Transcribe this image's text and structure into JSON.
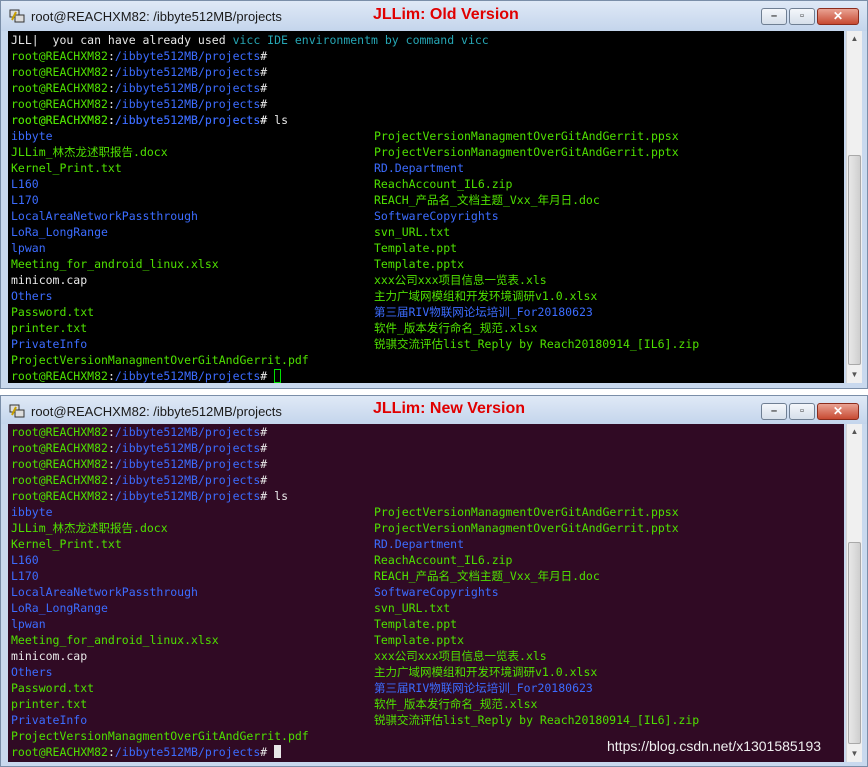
{
  "colors": {
    "green": "#4fe000",
    "blue": "#3c6cff",
    "white": "#e8e8e8",
    "cyan": "#26a6b4"
  },
  "top": {
    "title": "root@REACHXM82: /ibbyte512MB/projects",
    "tag": "JLLim:  Old Version",
    "info": {
      "prefix": "JLL|  you can have already used ",
      "highlight": "vicc IDE environmentm by command vicc"
    },
    "prompt_user": "root@REACHXM82",
    "prompt_sep": ":",
    "prompt_path": "/ibbyte512MB/projects",
    "prompt_end": "#",
    "cmd": " ls"
  },
  "bottom": {
    "title": "root@REACHXM82: /ibbyte512MB/projects",
    "tag": "JLLim: New Version",
    "prompt_user": "root@REACHXM82",
    "prompt_sep": ":",
    "prompt_path": "/ibbyte512MB/projects",
    "prompt_end": "#",
    "cmd": " ls"
  },
  "listing": [
    {
      "left": {
        "text": "ibbyte",
        "kind": "dir"
      },
      "right": {
        "text": "ProjectVersionManagmentOverGitAndGerrit.ppsx",
        "kind": "file"
      }
    },
    {
      "left": {
        "text": "JLLim_林杰龙述职报告.docx",
        "kind": "file"
      },
      "right": {
        "text": "ProjectVersionManagmentOverGitAndGerrit.pptx",
        "kind": "file"
      }
    },
    {
      "left": {
        "text": "Kernel_Print.txt",
        "kind": "file"
      },
      "right": {
        "text": "RD.Department",
        "kind": "dir"
      }
    },
    {
      "left": {
        "text": "L160",
        "kind": "dir"
      },
      "right": {
        "text": "ReachAccount_IL6.zip",
        "kind": "file"
      }
    },
    {
      "left": {
        "text": "L170",
        "kind": "dir"
      },
      "right": {
        "text": "REACH_产品名_文档主题_Vxx_年月日.doc",
        "kind": "file"
      }
    },
    {
      "left": {
        "text": "LocalAreaNetworkPassthrough",
        "kind": "dir"
      },
      "right": {
        "text": "SoftwareCopyrights",
        "kind": "dir"
      }
    },
    {
      "left": {
        "text": "LoRa_LongRange",
        "kind": "dir"
      },
      "right": {
        "text": "svn_URL.txt",
        "kind": "file"
      }
    },
    {
      "left": {
        "text": "lpwan",
        "kind": "dir"
      },
      "right": {
        "text": "Template.ppt",
        "kind": "file"
      }
    },
    {
      "left": {
        "text": "Meeting_for_android_linux.xlsx",
        "kind": "file"
      },
      "right": {
        "text": "Template.pptx",
        "kind": "file"
      }
    },
    {
      "left": {
        "text": "minicom.cap",
        "kind": "plain"
      },
      "right": {
        "text": "xxx公司xxx项目信息一览表.xls",
        "kind": "file"
      }
    },
    {
      "left": {
        "text": "Others",
        "kind": "dir"
      },
      "right": {
        "text": "主力广域网模组和开发环境调研v1.0.xlsx",
        "kind": "file"
      }
    },
    {
      "left": {
        "text": "Password.txt",
        "kind": "file"
      },
      "right": {
        "text": "第三届RIV物联网论坛培训_For20180623",
        "kind": "dir"
      }
    },
    {
      "left": {
        "text": "printer.txt",
        "kind": "file"
      },
      "right": {
        "text": "软件_版本发行命名_规范.xlsx",
        "kind": "file"
      }
    },
    {
      "left": {
        "text": "PrivateInfo",
        "kind": "dir"
      },
      "right": {
        "text": "锐骐交流评估list_Reply by Reach20180914_[IL6].zip",
        "kind": "file"
      }
    },
    {
      "left": {
        "text": "ProjectVersionManagmentOverGitAndGerrit.pdf",
        "kind": "file"
      },
      "right": null
    }
  ],
  "watermark": "https://blog.csdn.net/x1301585193"
}
